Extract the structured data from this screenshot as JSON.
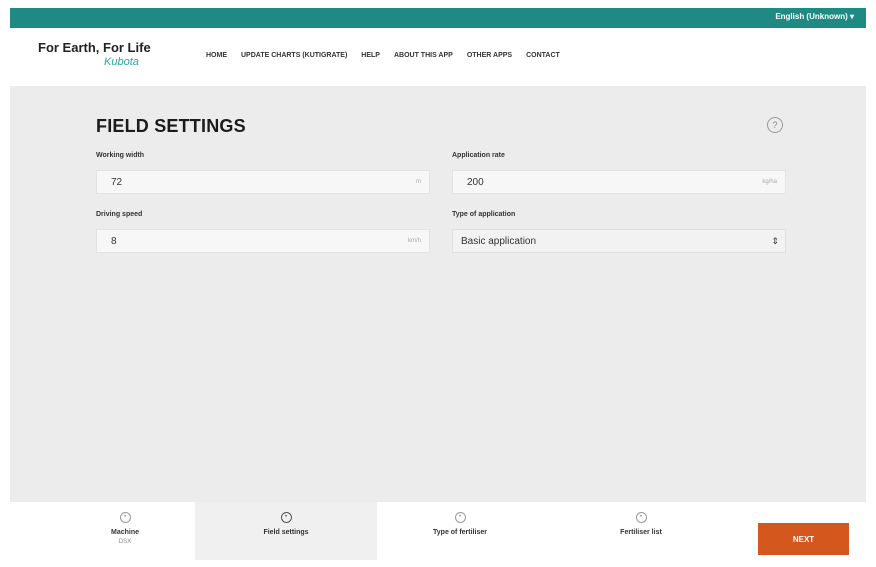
{
  "topbar": {
    "language": "English (Unknown) ▾"
  },
  "header": {
    "logo_main": "For Earth, For Life",
    "logo_brand": "Kubota",
    "nav": [
      "HOME",
      "UPDATE CHARTS (KUTIGRATE)",
      "HELP",
      "ABOUT THIS APP",
      "OTHER APPS",
      "CONTACT"
    ]
  },
  "page": {
    "title": "FIELD SETTINGS",
    "help_icon": "?"
  },
  "form": {
    "working_width": {
      "label": "Working width",
      "value": "72",
      "unit": "m"
    },
    "application_rate": {
      "label": "Application rate",
      "value": "200",
      "unit": "kg/ha"
    },
    "driving_speed": {
      "label": "Driving speed",
      "value": "8",
      "unit": "km/h"
    },
    "type_of_application": {
      "label": "Type of application",
      "value": "Basic application"
    }
  },
  "footer": {
    "steps": [
      {
        "label": "Machine",
        "sub": "DSX"
      },
      {
        "label": "Field settings",
        "sub": ""
      },
      {
        "label": "Type of fertiliser",
        "sub": ""
      },
      {
        "label": "Fertiliser list",
        "sub": ""
      }
    ],
    "next_label": "NEXT"
  },
  "colors": {
    "accent": "#1f8a83",
    "brand": "#2aa79b",
    "button": "#d4571d"
  }
}
